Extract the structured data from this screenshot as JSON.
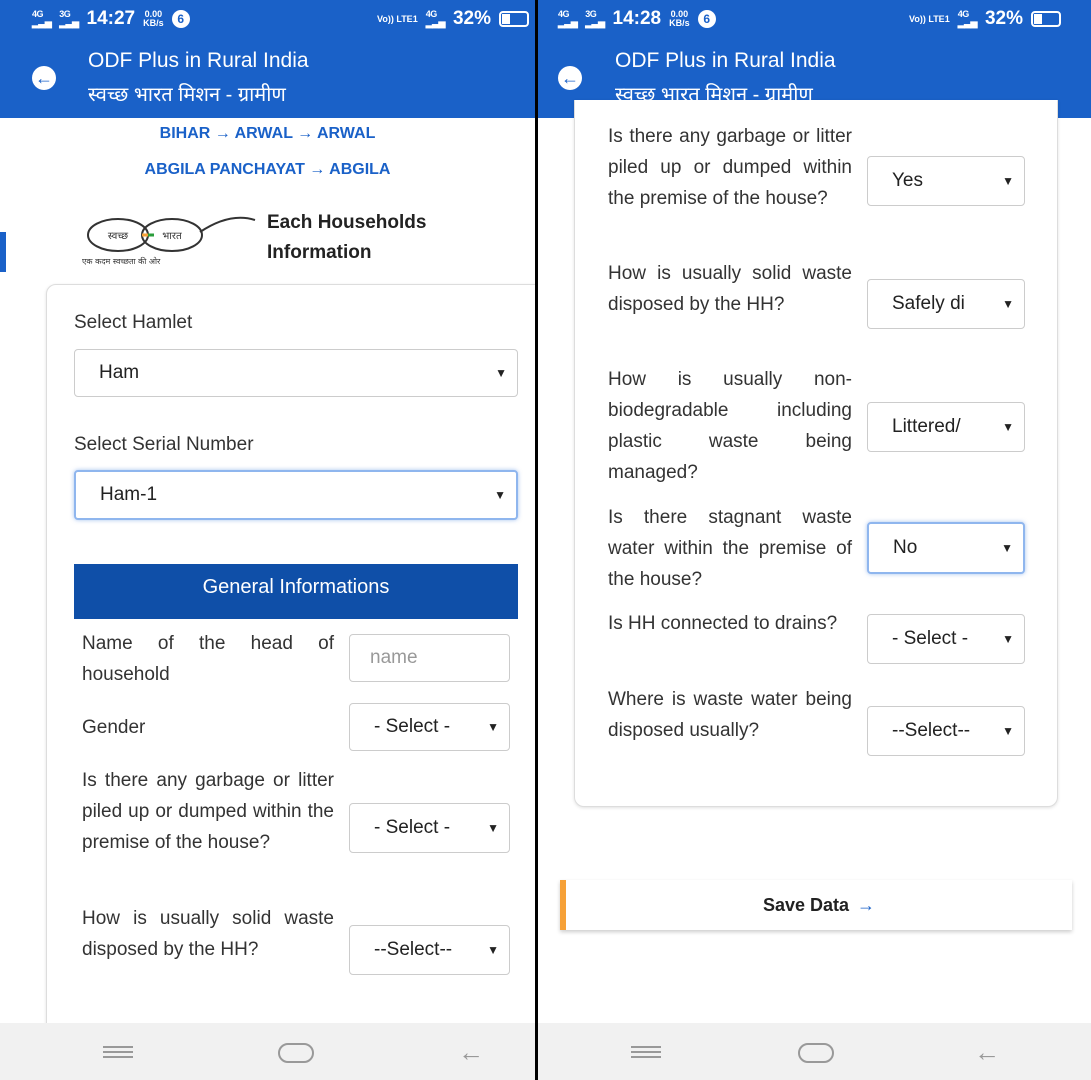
{
  "left": {
    "status": {
      "net1": "4G",
      "net2": "3G",
      "time": "14:27",
      "speed": "0.00",
      "speed_unit": "KB/s",
      "notif": "6",
      "volte": "Vo)) LTE1",
      "net3": "4G",
      "battery": "32%"
    },
    "appbar": {
      "title": "ODF Plus in Rural India",
      "subtitle": "स्वच्छ भारत मिशन - ग्रामीण"
    },
    "breadcrumb": {
      "line1": "BIHAR → ARWAL → ARWAL",
      "line2": "ABGILA PANCHAYAT → ABGILA"
    },
    "logo": {
      "text_left": "स्वच्छ",
      "text_right": "भारत",
      "tagline": "एक कदम स्वच्छता की ओर"
    },
    "section_title": {
      "line1": "Each Households",
      "line2": "Information"
    },
    "hamlet": {
      "label": "Select Hamlet",
      "value": "Ham"
    },
    "serial": {
      "label": "Select Serial Number",
      "value": "Ham-1"
    },
    "general_header": "General Informations",
    "form": {
      "head_label": "Name of the head of household",
      "head_placeholder": "name",
      "gender_label": "Gender",
      "gender_value": "- Select -",
      "garbage_label": "Is there any garbage or litter piled up or dumped within the premise of the house?",
      "garbage_value": "- Select -",
      "solid_label": "How is usually solid waste disposed by the HH?",
      "solid_value": "--Select--"
    }
  },
  "right": {
    "status": {
      "net1": "4G",
      "net2": "3G",
      "time": "14:28",
      "speed": "0.00",
      "speed_unit": "KB/s",
      "notif": "6",
      "volte": "Vo)) LTE1",
      "net3": "4G",
      "battery": "32%"
    },
    "appbar": {
      "title": "ODF Plus in Rural India",
      "subtitle": "स्वच्छ भारत मिशन - ग्रामीण"
    },
    "form": {
      "garbage_label": "Is there any garbage or litter piled up or dumped within the premise of the house?",
      "garbage_value": "Yes",
      "solid_label": "How is usually solid waste disposed by the HH?",
      "solid_value": "Safely di",
      "nonbio_label": "How is usually non-biodegradable including plastic waste being managed?",
      "nonbio_value": "Littered/",
      "stagnant_label": "Is there stagnant waste water within the premise of the house?",
      "stagnant_value": "No",
      "drains_label": "Is HH connected to drains?",
      "drains_value": "- Select -",
      "wastewater_label": "Where is waste water being disposed usually?",
      "wastewater_value": "--Select--"
    },
    "save_label": "Save Data"
  }
}
